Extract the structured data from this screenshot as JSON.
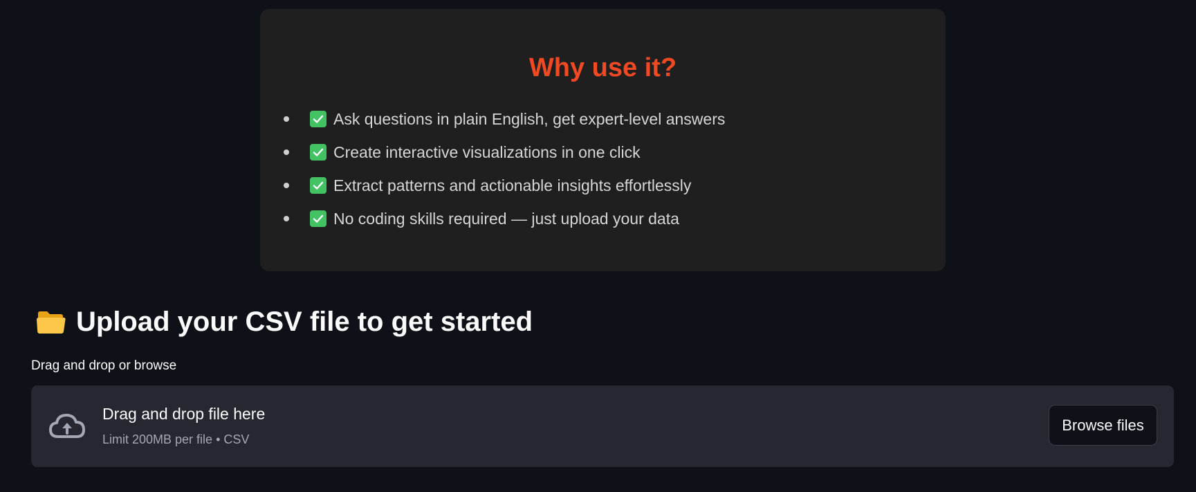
{
  "card": {
    "title": "Why use it?",
    "features": [
      {
        "text": "Ask questions in plain English, get expert-level answers",
        "icon": "check-mark-icon"
      },
      {
        "text": "Create interactive visualizations in one click",
        "icon": "check-mark-icon"
      },
      {
        "text": "Extract patterns and actionable insights effortlessly",
        "icon": "check-mark-icon"
      },
      {
        "text": "No coding skills required — just upload your data",
        "icon": "check-mark-icon"
      }
    ]
  },
  "upload": {
    "icon": "folder-icon",
    "title": "Upload your CSV file to get started",
    "label": "Drag and drop or browse",
    "dropzone": {
      "icon": "cloud-upload-icon",
      "main_text": "Drag and drop file here",
      "sub_text": "Limit 200MB per file • CSV",
      "button_label": "Browse files"
    }
  },
  "colors": {
    "background": "#0e1118",
    "card_background": "#1f1f1f",
    "title_accent": "#f04a24",
    "check_green": "#43c264",
    "dropzone_background": "#262730"
  }
}
